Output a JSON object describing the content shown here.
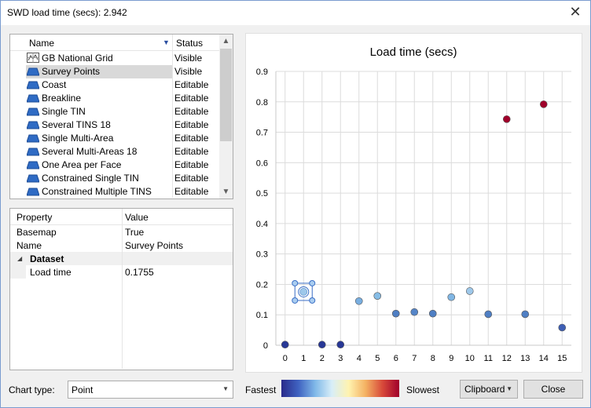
{
  "window": {
    "title": "SWD load time (secs): 2.942",
    "close_glyph": "✕"
  },
  "layers": {
    "columns": [
      "Name",
      "Status"
    ],
    "rows": [
      {
        "name": "GB National Grid",
        "status": "Visible",
        "icon": "grid-icon"
      },
      {
        "name": "Survey Points",
        "status": "Visible",
        "icon": "layer-icon",
        "selected": true
      },
      {
        "name": "Coast",
        "status": "Editable",
        "icon": "layer-icon"
      },
      {
        "name": "Breakline",
        "status": "Editable",
        "icon": "layer-icon"
      },
      {
        "name": "Single TIN",
        "status": "Editable",
        "icon": "layer-icon"
      },
      {
        "name": "Several TINS 18",
        "status": "Editable",
        "icon": "layer-icon"
      },
      {
        "name": "Single Multi-Area",
        "status": "Editable",
        "icon": "layer-icon"
      },
      {
        "name": "Several Multi-Areas 18",
        "status": "Editable",
        "icon": "layer-icon"
      },
      {
        "name": "One Area per Face",
        "status": "Editable",
        "icon": "layer-icon"
      },
      {
        "name": "Constrained Single TIN",
        "status": "Editable",
        "icon": "layer-icon"
      },
      {
        "name": "Constrained Multiple TINS",
        "status": "Editable",
        "icon": "layer-icon"
      }
    ]
  },
  "properties": {
    "columns": [
      "Property",
      "Value"
    ],
    "rows": [
      {
        "key": "Basemap",
        "value": "True"
      },
      {
        "key": "Name",
        "value": "Survey Points"
      }
    ],
    "group": {
      "label": "Dataset",
      "rows": [
        {
          "key": "Load time",
          "value": "0.1755"
        }
      ]
    }
  },
  "chart_data": {
    "type": "scatter",
    "title": "Load time (secs)",
    "xlabel": "",
    "ylabel": "",
    "xlim": [
      -0.5,
      15.5
    ],
    "ylim": [
      0,
      0.9
    ],
    "x_ticks": [
      "0",
      "1",
      "2",
      "3",
      "4",
      "5",
      "6",
      "7",
      "8",
      "9",
      "10",
      "11",
      "12",
      "13",
      "14",
      "15"
    ],
    "y_ticks": [
      "0",
      "0.1",
      "0.2",
      "0.3",
      "0.4",
      "0.5",
      "0.6",
      "0.7",
      "0.8",
      "0.9"
    ],
    "grid": true,
    "points": [
      {
        "x": 0,
        "y": 0.002,
        "color": "#283896"
      },
      {
        "x": 1,
        "y": 0.1755,
        "color": "#9ec8ea",
        "selected": true
      },
      {
        "x": 2,
        "y": 0.002,
        "color": "#283896"
      },
      {
        "x": 3,
        "y": 0.002,
        "color": "#283896"
      },
      {
        "x": 4,
        "y": 0.145,
        "color": "#78aee0"
      },
      {
        "x": 5,
        "y": 0.162,
        "color": "#86bde6"
      },
      {
        "x": 6,
        "y": 0.104,
        "color": "#4f7fc4"
      },
      {
        "x": 7,
        "y": 0.109,
        "color": "#5585c8"
      },
      {
        "x": 8,
        "y": 0.104,
        "color": "#4f7fc4"
      },
      {
        "x": 9,
        "y": 0.158,
        "color": "#80b6e4"
      },
      {
        "x": 10,
        "y": 0.178,
        "color": "#9ec8ea"
      },
      {
        "x": 11,
        "y": 0.102,
        "color": "#4f7fc4"
      },
      {
        "x": 12,
        "y": 0.743,
        "color": "#a0002a"
      },
      {
        "x": 13,
        "y": 0.102,
        "color": "#4f7fc4"
      },
      {
        "x": 14,
        "y": 0.792,
        "color": "#a0002a"
      },
      {
        "x": 15,
        "y": 0.058,
        "color": "#3e5fb5"
      }
    ]
  },
  "footer": {
    "chart_type_label": "Chart type:",
    "chart_type_value": "Point",
    "fastest_label": "Fastest",
    "slowest_label": "Slowest",
    "clipboard_label": "Clipboard",
    "close_label": "Close"
  }
}
